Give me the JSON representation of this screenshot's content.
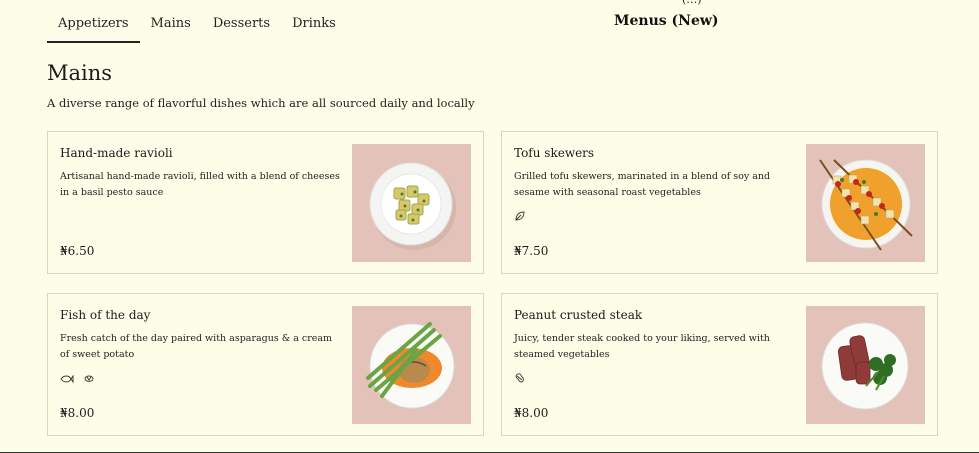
{
  "tabs": [
    {
      "label": "Appetizers"
    },
    {
      "label": "Mains"
    },
    {
      "label": "Desserts"
    },
    {
      "label": "Drinks"
    }
  ],
  "overlay": {
    "title": "Menus (New)",
    "peek": "(…)"
  },
  "section": {
    "title": "Mains",
    "description": "A diverse range of flavorful dishes which are all sourced daily and locally"
  },
  "items": [
    {
      "name": "Hand-made ravioli",
      "description": "Artisanal hand-made ravioli, filled with a blend of cheeses in a basil pesto sauce",
      "price": "₦6.50",
      "icons": []
    },
    {
      "name": "Tofu skewers",
      "description": "Grilled tofu skewers, marinated in a blend of soy and sesame with seasonal roast vegetables",
      "price": "₦7.50",
      "icons": [
        "vegan-leaf-icon"
      ]
    },
    {
      "name": "Fish of the day",
      "description": "Fresh catch of the day paired with asparagus & a cream of sweet potato",
      "price": "₦8.00",
      "icons": [
        "fish-icon",
        "shellfish-icon"
      ]
    },
    {
      "name": "Peanut crusted steak",
      "description": "Juicy, tender steak cooked to your liking, served with steamed vegetables",
      "price": "₦8.00",
      "icons": [
        "peanut-icon"
      ]
    }
  ],
  "colors": {
    "background": "#fdfde8",
    "image_bg": "#e3c2b9",
    "border": "#d6d6c2"
  }
}
